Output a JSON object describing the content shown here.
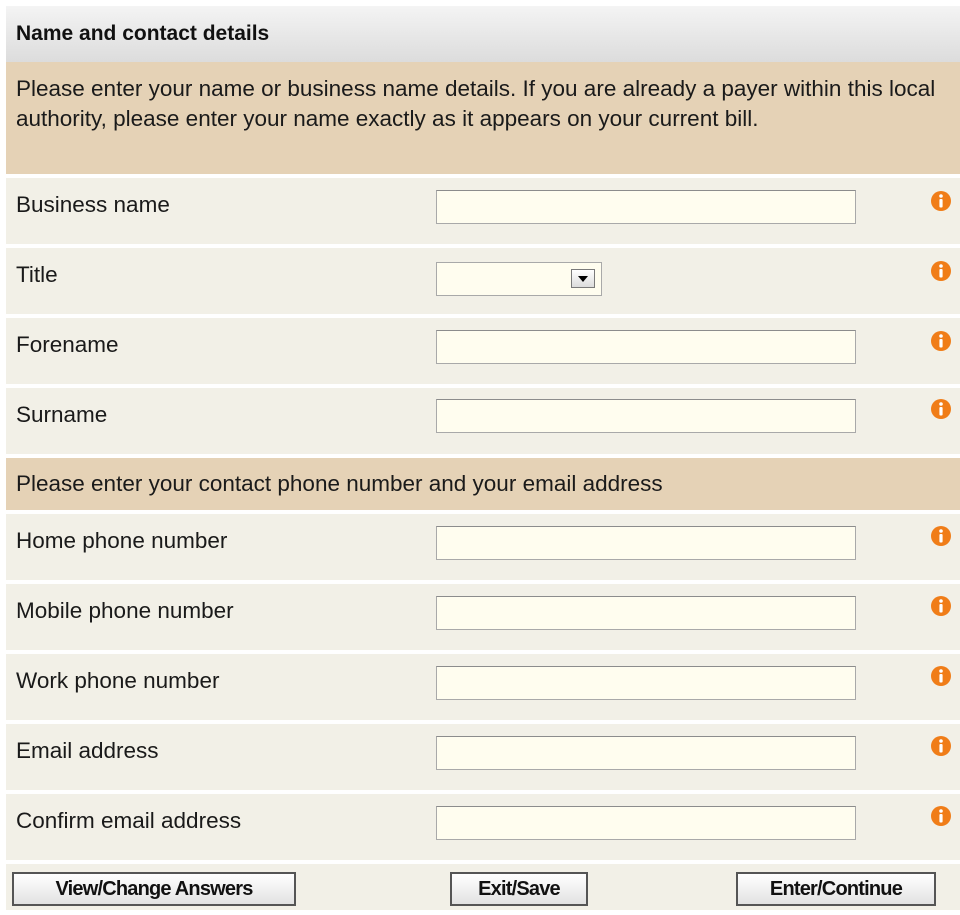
{
  "section": {
    "title": "Name and contact details",
    "intro": "Please enter your name or business name details. If you are already a payer within this local authority, please enter your name exactly as it appears on your current bill.",
    "contact_intro": "Please enter your contact phone number and your email address"
  },
  "name_fields": [
    {
      "label": "Business name",
      "value": "",
      "icon": "info-icon"
    },
    {
      "label": "Title",
      "value": "",
      "icon": "info-icon"
    },
    {
      "label": "Forename",
      "value": "",
      "icon": "info-icon"
    },
    {
      "label": "Surname",
      "value": "",
      "icon": "info-icon"
    }
  ],
  "contact_fields": [
    {
      "label": "Home phone number",
      "value": "",
      "icon": "info-icon"
    },
    {
      "label": "Mobile phone number",
      "value": "",
      "icon": "info-icon"
    },
    {
      "label": "Work phone number",
      "value": "",
      "icon": "info-icon"
    },
    {
      "label": "Email address",
      "value": "",
      "icon": "info-icon"
    },
    {
      "label": "Confirm email address",
      "value": "",
      "icon": "info-icon"
    }
  ],
  "buttons": {
    "view_change": "View/Change Answers",
    "exit_save": "Exit/Save",
    "enter_continue": "Enter/Continue"
  },
  "colors": {
    "info_icon": "#f07d18",
    "intro_background": "#e5d2b6",
    "row_background": "#f2f0e7",
    "input_background": "#fffdef"
  }
}
